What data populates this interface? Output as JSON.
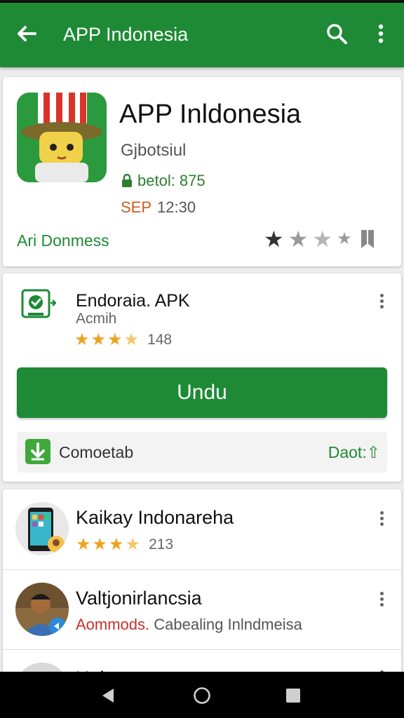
{
  "appbar": {
    "title": "APP Indonesia",
    "back_icon": "arrow-back-icon",
    "search_icon": "search-icon",
    "more_icon": "more-vert-icon",
    "color": "#1e8a35"
  },
  "app_header": {
    "name": "APP Inldonesia",
    "developer": "Gjbotsiul",
    "meta_line": "betol: 875",
    "meta_tag": "SEP",
    "meta_time": "12:30",
    "category_link": "Ari Donmess",
    "rating_stars_filled": 2,
    "rating_stars_total": 4
  },
  "apk_card": {
    "title": "Endoraia. APK",
    "subtitle": "Acmih",
    "rating": 3.5,
    "rating_count": "148",
    "download_label": "Undu",
    "download_row_label": "Comoetab",
    "download_row_action": "Daot:"
  },
  "list": {
    "items": [
      {
        "title": "Kaikay Indonareha",
        "rating": 3.5,
        "count": "213"
      },
      {
        "title": "Valtjonirlancsia",
        "sub_red": "Aommods.",
        "sub_text": "Cabealing Inlndmeisa"
      },
      {
        "title": "Haleet"
      }
    ]
  },
  "navbar": {
    "back_icon": "nav-back-icon",
    "home_icon": "nav-home-icon",
    "recents_icon": "nav-recents-icon"
  }
}
